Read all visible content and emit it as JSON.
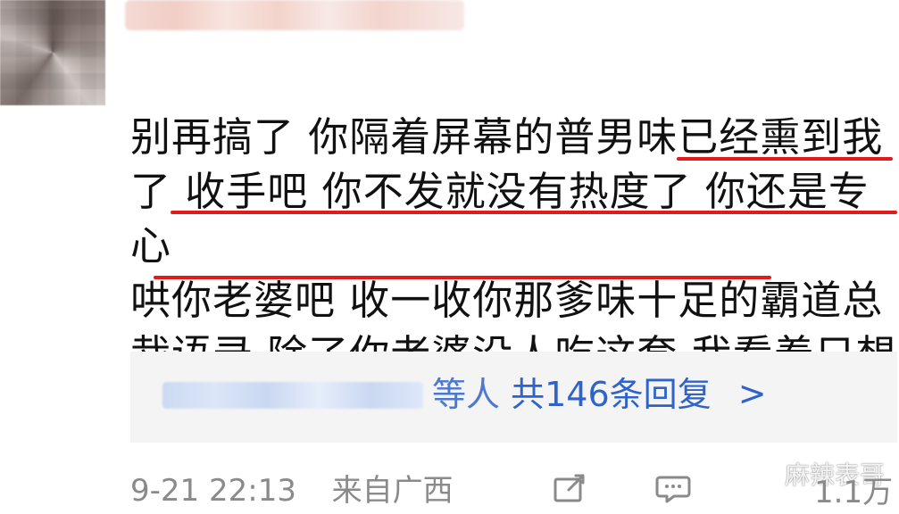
{
  "comment": {
    "text": "别再搞了 你隔着屏幕的普男味已经熏到我\n了 收手吧 你不发就没有热度了 你还是专心\n哄你老婆吧 收一收你那爹味十足的霸道总\n裁语录 除了你老婆没人吃这套 我看着只想\n呕 祝你们幸福",
    "emoji": "sweat-face-emoji"
  },
  "reply": {
    "prefix_blurred": "",
    "suffix": "等人",
    "count_text": "共146条回复",
    "chevron": ">"
  },
  "meta": {
    "timestamp": "9-21 22:13",
    "source": "来自广西",
    "share_icon": "share-icon",
    "comment_icon": "comment-icon",
    "like_count": "1.1万"
  },
  "watermark": {
    "text": "麻辣表哥",
    "icon": "wechat-icon"
  },
  "colors": {
    "highlight": "#e11b1b",
    "link": "#2f63c9",
    "meta": "#8a8a8a",
    "text": "#111111",
    "reply_bg": "#f4f4f4"
  }
}
